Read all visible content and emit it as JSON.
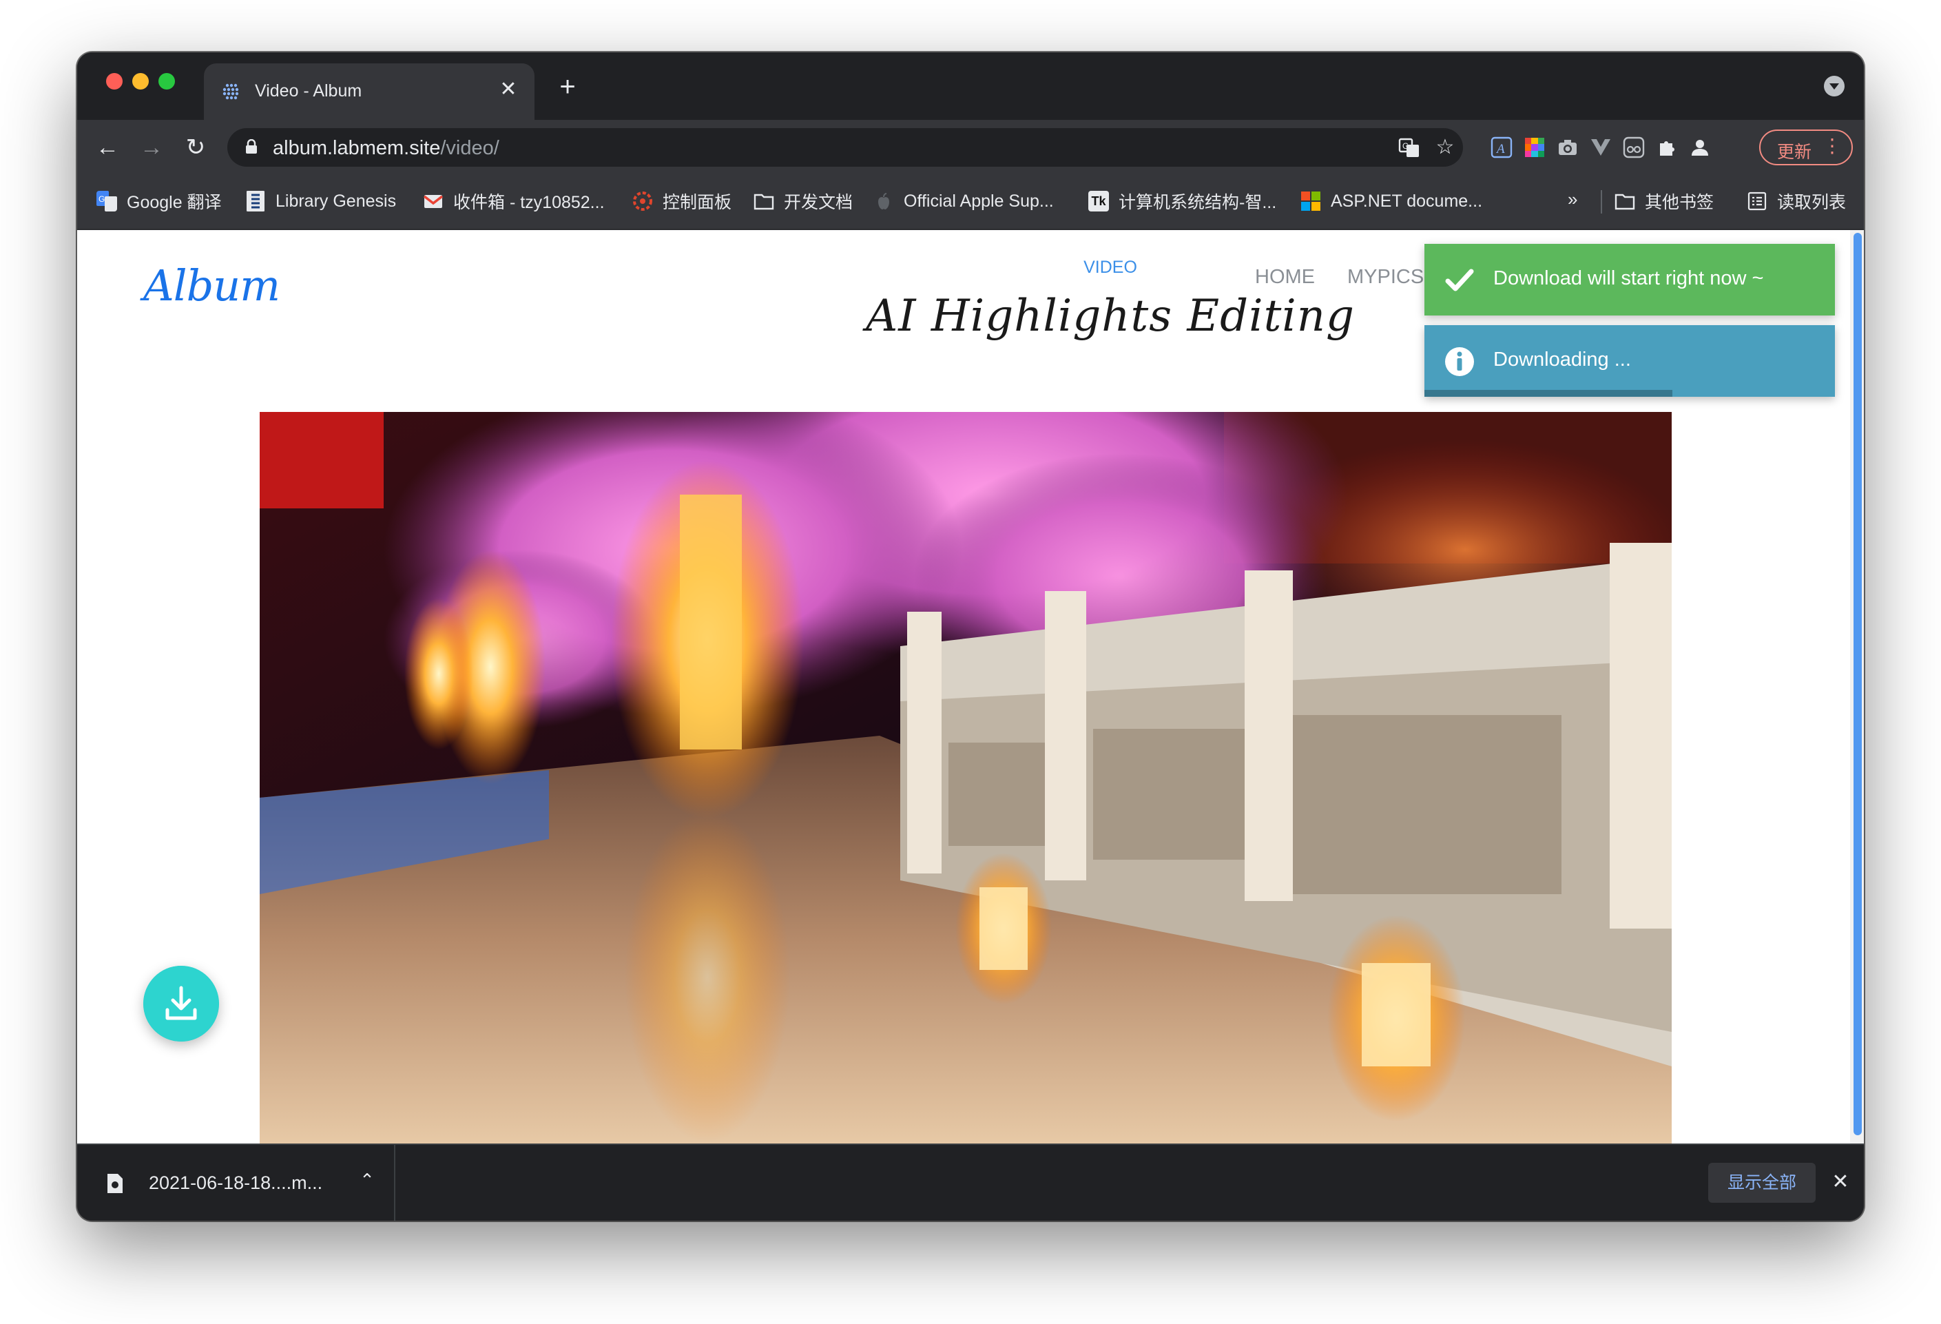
{
  "browser": {
    "tab": {
      "title": "Video - Album",
      "close": "✕"
    },
    "new_tab": "+",
    "url": {
      "host": "album.labmem.site",
      "path": "/video/"
    },
    "update_label": "更新",
    "menu_dots": "⋮",
    "bookmarks": [
      {
        "label": "Google 翻译",
        "icon": "google-translate-icon"
      },
      {
        "label": "Library Genesis",
        "icon": "library-genesis-icon"
      },
      {
        "label": "收件箱 - tzy10852...",
        "icon": "gmail-icon"
      },
      {
        "label": "控制面板",
        "icon": "control-panel-icon"
      },
      {
        "label": "开发文档",
        "icon": "folder-icon"
      },
      {
        "label": "Official Apple Sup...",
        "icon": "apple-icon"
      },
      {
        "label": "计算机系统结构-智...",
        "icon": "tk-icon",
        "icon_text": "Tk"
      },
      {
        "label": "ASP.NET docume...",
        "icon": "microsoft-icon"
      }
    ],
    "bookmarks_more": "»",
    "other_bookmarks": "其他书签",
    "reading_list": "读取列表"
  },
  "page": {
    "logo": "Album",
    "subtitle": "VIDEO",
    "headline": "AI Highlights Editing",
    "nav": [
      "HOME",
      "MYPICS"
    ],
    "hero_image": "cherry-blossom-lantern-courtyard-image"
  },
  "toasts": [
    {
      "type": "success",
      "text": "Download will start right now ~",
      "color": "#5cb85c"
    },
    {
      "type": "info",
      "text": "Downloading ...",
      "color": "#4a9fbe"
    }
  ],
  "downloads": {
    "file": "2021-06-18-18....m...",
    "show_all": "显示全部",
    "close": "✕"
  },
  "colors": {
    "accent": "#1a73e8",
    "fab": "#2dd4cf",
    "update": "#f28b82"
  }
}
